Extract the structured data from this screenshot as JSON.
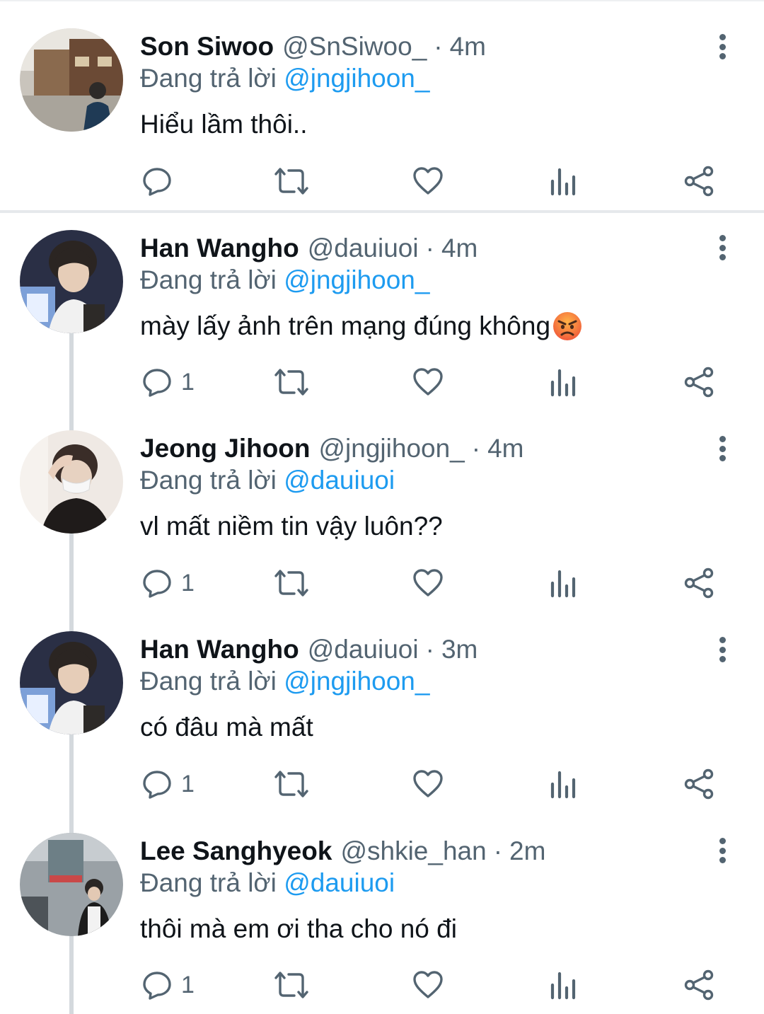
{
  "reply_prefix": "Đang trả lời",
  "tweets": [
    {
      "name": "Son Siwoo",
      "handle": "@SnSiwoo_",
      "separator": "·",
      "time": "4m",
      "reply_to": "@jngjihoon_",
      "text": "Hiểu lầm thôi..",
      "reply_count": ""
    },
    {
      "name": "Han Wangho",
      "handle": "@dauiuoi",
      "separator": "·",
      "time": "4m",
      "reply_to": "@jngjihoon_",
      "text": "mày lấy ảnh trên mạng đúng không",
      "emoji": "angry-face-emoji",
      "reply_count": "1"
    },
    {
      "name": "Jeong Jihoon",
      "handle": "@jngjihoon_",
      "separator": "·",
      "time": "4m",
      "reply_to": "@dauiuoi",
      "text": "vl mất niềm tin vậy luôn??",
      "reply_count": "1"
    },
    {
      "name": "Han Wangho",
      "handle": "@dauiuoi",
      "separator": "·",
      "time": "3m",
      "reply_to": "@jngjihoon_",
      "text": "có đâu mà mất",
      "reply_count": "1"
    },
    {
      "name": "Lee Sanghyeok",
      "handle": "@shkie_han",
      "separator": "·",
      "time": "2m",
      "reply_to": "@dauiuoi",
      "text": "thôi mà em ơi tha cho nó đi",
      "reply_count": "1"
    }
  ],
  "icons": {
    "reply": "reply-bubble-icon",
    "retweet": "retweet-icon",
    "like": "heart-icon",
    "views": "bar-chart-icon",
    "share": "share-icon",
    "more": "more-vertical-icon"
  },
  "colors": {
    "text": "#0f1419",
    "secondary": "#536471",
    "link": "#1d9bf0",
    "thread_line": "#d4d9dd"
  }
}
